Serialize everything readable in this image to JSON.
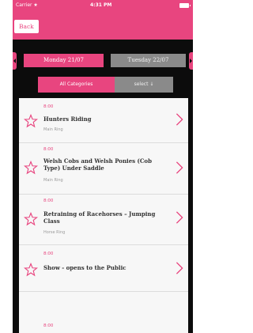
{
  "status_bar": {
    "carrier": "Carrier ★",
    "time": "4:31 PM"
  },
  "nav": {
    "back_label": "Back"
  },
  "days": {
    "active": "Monday 21/07",
    "inactive": "Tuesday 22/07"
  },
  "filter": {
    "categories_label": "All Categories",
    "select_label": "select ↓"
  },
  "events": [
    {
      "time": "8:00",
      "title": "Hunters Riding",
      "venue": "Main Ring"
    },
    {
      "time": "8:00",
      "title": "Welsh Cobs and Welsh Ponies (Cob Type) Under Saddle",
      "venue": "Main Ring"
    },
    {
      "time": "8:00",
      "title": "Retraining of Racehorses – Jumping Class",
      "venue": "Horse Ring"
    },
    {
      "time": "8:00",
      "title": "Show - opens to the Public",
      "venue": ""
    },
    {
      "time": "8:00",
      "title": "",
      "venue": ""
    }
  ],
  "colors": {
    "accent": "#e8457f",
    "inactive": "#8a8a8a",
    "background": "#0c0c0c"
  }
}
